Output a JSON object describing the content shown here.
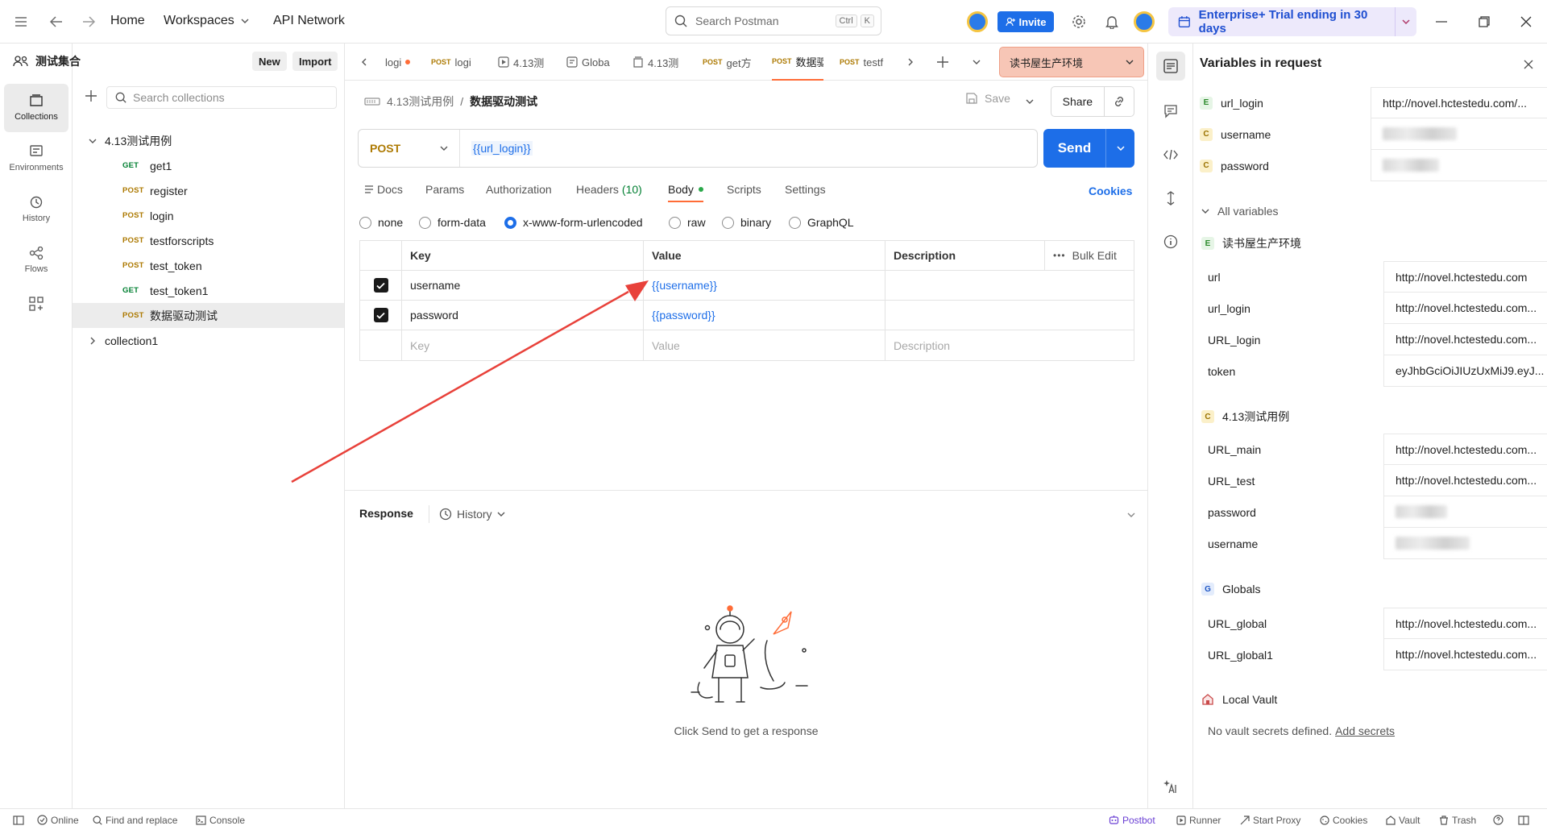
{
  "topbar": {
    "home": "Home",
    "workspaces": "Workspaces",
    "api_network": "API Network",
    "search_placeholder": "Search Postman",
    "kbd_ctrl": "Ctrl",
    "kbd_k": "K",
    "invite": "Invite",
    "trial": "Enterprise+ Trial ending in 30 days"
  },
  "rail": {
    "collections": "Collections",
    "environments": "Environments",
    "history": "History",
    "flows": "Flows"
  },
  "sidebar": {
    "workspace_name": "测试集合",
    "new_btn": "New",
    "import_btn": "Import",
    "search_placeholder": "Search collections",
    "collection": "4.13测试用例",
    "items": [
      {
        "method": "GET",
        "name": "get1"
      },
      {
        "method": "POST",
        "name": "register"
      },
      {
        "method": "POST",
        "name": "login"
      },
      {
        "method": "POST",
        "name": "testforscripts"
      },
      {
        "method": "POST",
        "name": "test_token"
      },
      {
        "method": "GET",
        "name": "test_token1"
      },
      {
        "method": "POST",
        "name": "数据驱动测试"
      }
    ],
    "collection2": "collection1"
  },
  "tabs": [
    {
      "method": "",
      "name": "logi"
    },
    {
      "method": "POST",
      "name": "logi"
    },
    {
      "method": "",
      "name": "4.13测"
    },
    {
      "method": "",
      "name": "Globa"
    },
    {
      "method": "",
      "name": "4.13测"
    },
    {
      "method": "POST",
      "name": "get方"
    },
    {
      "method": "POST",
      "name": "数据驱"
    },
    {
      "method": "POST",
      "name": "testf"
    }
  ],
  "env": {
    "selected": "读书屋生产环境"
  },
  "request": {
    "breadcrumb_parent": "4.13测试用例",
    "breadcrumb_sep": "/",
    "breadcrumb_current": "数据驱动测试",
    "save": "Save",
    "share": "Share",
    "method": "POST",
    "url": "{{url_login}}",
    "send": "Send",
    "tabs": {
      "docs": "Docs",
      "params": "Params",
      "authorization": "Authorization",
      "headers": "Headers",
      "headers_count": "(10)",
      "body": "Body",
      "scripts": "Scripts",
      "settings": "Settings",
      "cookies": "Cookies"
    },
    "body_types": [
      "none",
      "form-data",
      "x-www-form-urlencoded",
      "raw",
      "binary",
      "GraphQL"
    ],
    "table": {
      "key_header": "Key",
      "value_header": "Value",
      "desc_header": "Description",
      "bulk_edit": "Bulk Edit",
      "rows": [
        {
          "key": "username",
          "value": "{{username}}"
        },
        {
          "key": "password",
          "value": "{{password}}"
        }
      ],
      "key_placeholder": "Key",
      "value_placeholder": "Value",
      "desc_placeholder": "Description"
    }
  },
  "response": {
    "title": "Response",
    "history": "History",
    "empty": "Click Send to get a response"
  },
  "variables": {
    "title": "Variables in request",
    "in_request": [
      {
        "scope": "E",
        "key": "url_login",
        "value": "http://novel.hctestedu.com/..."
      },
      {
        "scope": "C",
        "key": "username",
        "value": ""
      },
      {
        "scope": "C",
        "key": "password",
        "value": ""
      }
    ],
    "all_variables": "All variables",
    "env_name": "读书屋生产环境",
    "env_vars": [
      {
        "key": "url",
        "value": "http://novel.hctestedu.com"
      },
      {
        "key": "url_login",
        "value": "http://novel.hctestedu.com..."
      },
      {
        "key": "URL_login",
        "value": "http://novel.hctestedu.com..."
      },
      {
        "key": "token",
        "value": "eyJhbGciOiJIUzUxMiJ9.eyJ..."
      }
    ],
    "coll_name": "4.13测试用例",
    "coll_vars": [
      {
        "key": "URL_main",
        "value": "http://novel.hctestedu.com..."
      },
      {
        "key": "URL_test",
        "value": "http://novel.hctestedu.com..."
      },
      {
        "key": "password",
        "value": ""
      },
      {
        "key": "username",
        "value": ""
      }
    ],
    "globals_name": "Globals",
    "global_vars": [
      {
        "key": "URL_global",
        "value": "http://novel.hctestedu.com..."
      },
      {
        "key": "URL_global1",
        "value": "http://novel.hctestedu.com..."
      }
    ],
    "vault_name": "Local Vault",
    "vault_empty": "No vault secrets defined.",
    "vault_add": "Add secrets"
  },
  "statusbar": {
    "online": "Online",
    "find_replace": "Find and replace",
    "console": "Console",
    "postbot": "Postbot",
    "runner": "Runner",
    "start_proxy": "Start Proxy",
    "cookies": "Cookies",
    "vault": "Vault",
    "trash": "Trash"
  },
  "colors": {
    "accent": "#1d6ee8",
    "active_tab": "#ff6c37",
    "env_bg": "#f7c6b6",
    "arrow": "#e8413a"
  }
}
